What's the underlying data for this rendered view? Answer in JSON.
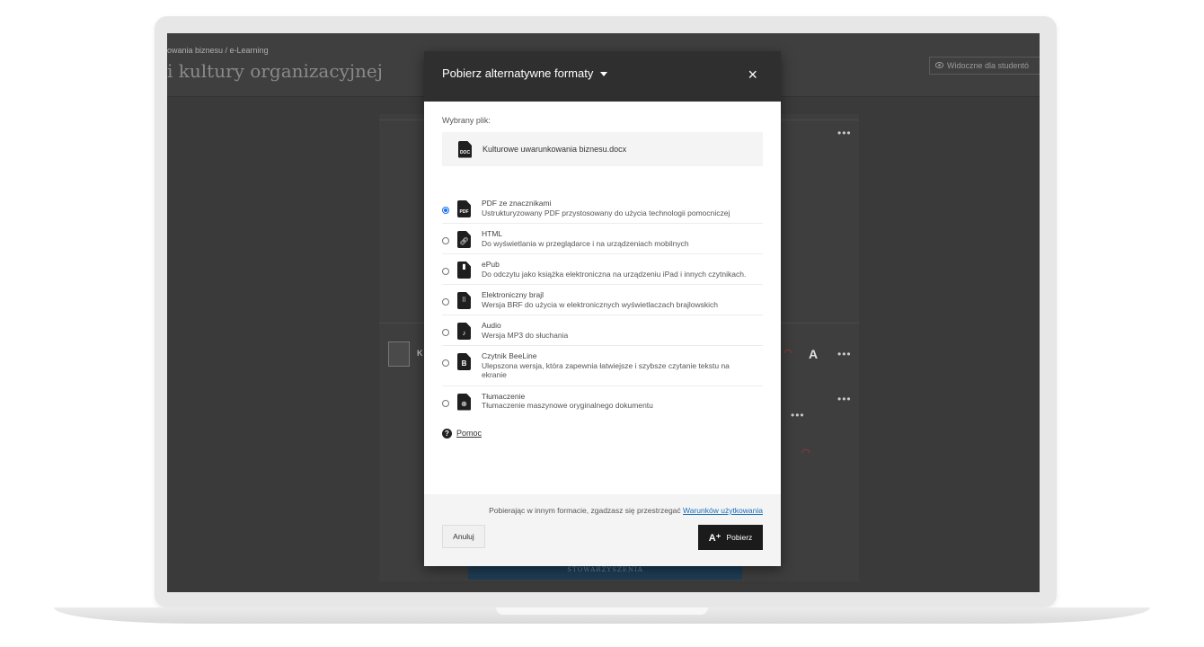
{
  "background": {
    "breadcrumb": "owania biznesu / e-Learning",
    "title": "i kultury organizacyjnej",
    "visibility_label": "Widoczne dla studentó",
    "item_initial": "K",
    "bottom_banner": "STOWARZYSZENIA"
  },
  "modal": {
    "title": "Pobierz alternatywne formaty",
    "close": "×",
    "selected_label": "Wybrany plik:",
    "selected_file": {
      "name": "Kulturowe uwarunkowania biznesu.docx",
      "icon_tag": "DOC"
    },
    "formats": [
      {
        "name": "PDF ze znacznikami",
        "desc": "Ustrukturyzowany PDF przystosowany do użycia technologii pomocniczej",
        "icon": "pdf-icon",
        "tag": "PDF",
        "selected": true
      },
      {
        "name": "HTML",
        "desc": "Do wyświetlania w przeglądarce i na urządzeniach mobilnych",
        "icon": "html-link-icon",
        "selected": false
      },
      {
        "name": "ePub",
        "desc": "Do odczytu jako książka elektroniczna na urządzeniu iPad i innych czytnikach.",
        "icon": "epub-bookmark-icon",
        "selected": false
      },
      {
        "name": "Elektroniczny brajl",
        "desc": "Wersja BRF do użycia w elektronicznych wyświetlaczach brajlowskich",
        "icon": "braille-icon",
        "selected": false
      },
      {
        "name": "Audio",
        "desc": "Wersja MP3 do słuchania",
        "icon": "audio-note-icon",
        "selected": false
      },
      {
        "name": "Czytnik BeeLine",
        "desc": "Ulepszona wersja, która zapewnia łatwiejsze i szybsze czytanie tekstu na ekranie",
        "icon": "beeline-icon",
        "selected": false
      },
      {
        "name": "Tłumaczenie",
        "desc": "Tłumaczenie maszynowe oryginalnego dokumentu",
        "icon": "globe-icon",
        "selected": false
      }
    ],
    "help_label": "Pomoc",
    "terms_text": "Pobierając w innym formacie, zgadzasz się przestrzegać ",
    "terms_link": "Warunków użytkowania",
    "cancel_label": "Anuluj",
    "download_label": "Pobierz"
  }
}
